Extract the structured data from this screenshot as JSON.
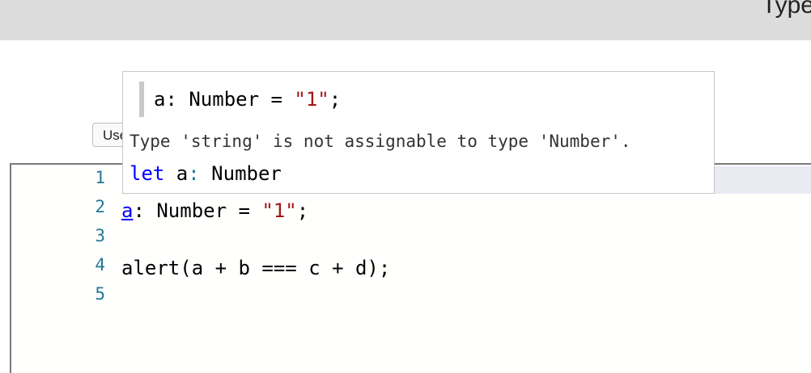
{
  "header": {
    "title": "Type"
  },
  "toolbar": {
    "button_label": "Use TypeScript"
  },
  "editor": {
    "line_numbers": [
      "1",
      "2",
      "3",
      "4",
      "5"
    ],
    "line2": {
      "var": "a",
      "rest_before": ": Number = ",
      "string": "\"1\"",
      "end": ";"
    },
    "line4": {
      "code": "alert(a + b === c + d);"
    }
  },
  "hover": {
    "signature": {
      "name": "a: Number = ",
      "string": "\"1\"",
      "end": ";"
    },
    "message": "Type 'string' is not assignable to type 'Number'.",
    "declaration": {
      "keyword": "let",
      "name": " a",
      "colon": ":",
      "type": " Number"
    }
  },
  "colors": {
    "keyword": "#0000ff",
    "string": "#a31515",
    "line_number": "#237893",
    "header_bg": "#dcdcdc"
  }
}
